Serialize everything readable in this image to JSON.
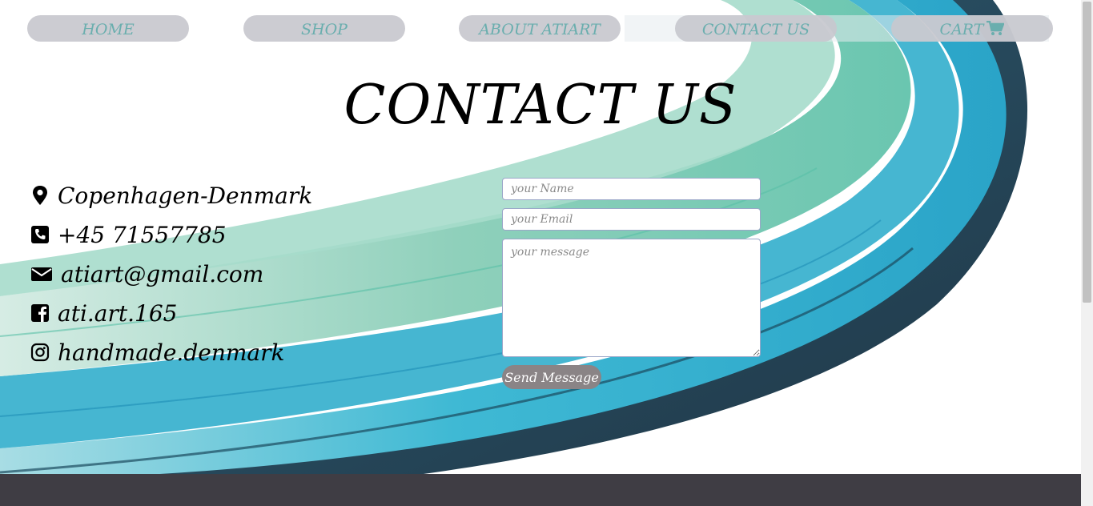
{
  "nav": {
    "items": [
      {
        "label": "HOME"
      },
      {
        "label": "SHOP"
      },
      {
        "label": "ABOUT ATIART"
      },
      {
        "label": "CONTACT US"
      },
      {
        "label": "CART"
      }
    ],
    "cart_icon": "shopping-cart-icon"
  },
  "page": {
    "title": "CONTACT US"
  },
  "contact": {
    "items": [
      {
        "icon": "map-marker-icon",
        "text": "Copenhagen-Denmark"
      },
      {
        "icon": "phone-square-icon",
        "text": "+45 71557785"
      },
      {
        "icon": "envelope-icon",
        "text": "atiart@gmail.com"
      },
      {
        "icon": "facebook-square-icon",
        "text": "ati.art.165"
      },
      {
        "icon": "instagram-icon",
        "text": "handmade.denmark"
      }
    ]
  },
  "form": {
    "name_placeholder": "your Name",
    "name_value": "",
    "email_placeholder": "your Email",
    "email_value": "",
    "message_placeholder": "your message",
    "message_value": "",
    "send_label": "Send Message"
  },
  "colors": {
    "nav_text": "#6aaeae",
    "nav_bg": "#c8c8ce",
    "button_bg": "#8a8486",
    "footer_bg": "#3f3d44"
  }
}
